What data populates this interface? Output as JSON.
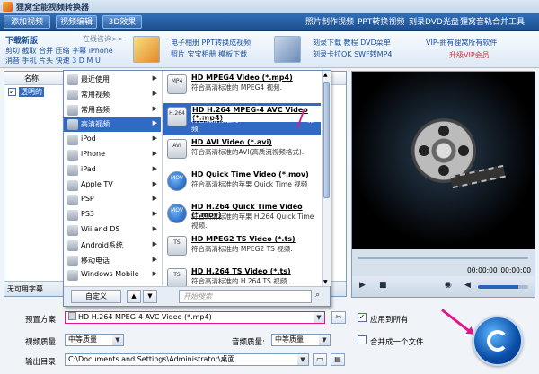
{
  "window": {
    "title": "狸窝全能视频转换器"
  },
  "toolbar": {
    "add_video": "添加视频",
    "edit_video": "视频编辑",
    "effect_3d": "3D效果",
    "links": [
      "照片制作视频",
      "PPT转换视频",
      "刻录DVD光盘",
      "狸窝音轨合并工具"
    ]
  },
  "promo": {
    "download_title": "下载新版",
    "online_help": "在线咨询>>",
    "left_lines": [
      "剪切 截取 合并 压缩 字幕 iPhone",
      "消音 手机 片头 快速 3 D M U"
    ],
    "mid_lines": [
      "电子相册 PPT转换成视频",
      "照片 宝宝相册 模板下载"
    ],
    "right_lines": [
      "刻录下载 教程 DVD菜单",
      "刻录卡拉OK SWF转MP4"
    ],
    "vip_line": "VIP-拥有狸窝所有软件",
    "vip_upgrade": "升级VIP会员"
  },
  "file_list": {
    "col_name": "名称",
    "row_file": "透明的",
    "subtitle_label": "无可用字幕"
  },
  "dropdown": {
    "categories": [
      {
        "label": "最近使用",
        "icon": "recent-icon"
      },
      {
        "label": "常用视频",
        "icon": "video-icon"
      },
      {
        "label": "常用音频",
        "icon": "audio-icon"
      },
      {
        "label": "高清视频",
        "icon": "hd-icon"
      },
      {
        "label": "iPod",
        "icon": "ipod-icon"
      },
      {
        "label": "iPhone",
        "icon": "iphone-icon"
      },
      {
        "label": "iPad",
        "icon": "ipad-icon"
      },
      {
        "label": "Apple TV",
        "icon": "appletv-icon"
      },
      {
        "label": "PSP",
        "icon": "psp-icon"
      },
      {
        "label": "PS3",
        "icon": "ps3-icon"
      },
      {
        "label": "Wii and DS",
        "icon": "wii-icon"
      },
      {
        "label": "Android系统",
        "icon": "android-icon"
      },
      {
        "label": "移动电话",
        "icon": "mobile-icon"
      },
      {
        "label": "Windows Mobile",
        "icon": "winmobile-icon"
      }
    ],
    "selected_category": 3,
    "formats": [
      {
        "title": "HD MPEG4 Video (*.mp4)",
        "desc": "符合高清标准的 MPEG4 视频.",
        "tag": "MP4"
      },
      {
        "title": "HD H.264 MPEG-4 AVC Video (*.mp4)",
        "desc": "符合高清标准的 H.264 MPEG-4 AVC 视频.",
        "tag": "H.264"
      },
      {
        "title": "HD AVI Video (*.avi)",
        "desc": "符合高清标准的AVI(高质流视频格式).",
        "tag": "AVI"
      },
      {
        "title": "HD Quick Time Video (*.mov)",
        "desc": "符合高清标准的苹果 Quick Time 视频",
        "tag": "MOV"
      },
      {
        "title": "HD H.264 Quick Time Video (*.mov)",
        "desc": "符合高清标准的苹果 H.264 Quick Time 视频.",
        "tag": "MOV"
      },
      {
        "title": "HD MPEG2 TS Video (*.ts)",
        "desc": "符合高清标准的 MPEG2 TS 视频.",
        "tag": "TS"
      },
      {
        "title": "HD H.264 TS Video (*.ts)",
        "desc": "符合高清标准的 H.264 TS 视频.",
        "tag": "TS"
      }
    ],
    "custom_label": "自定义",
    "search_placeholder": "开始搜索"
  },
  "preview": {
    "time_current": "00:00:00",
    "time_total": "00:00:00"
  },
  "settings": {
    "preset_label": "预置方案:",
    "preset_value": "HD H.264 MPEG-4 AVC Video (*.mp4)",
    "apply_all": "应用到所有",
    "video_quality_label": "视频质量:",
    "video_quality_value": "中等质量",
    "audio_quality_label": "音频质量:",
    "audio_quality_value": "中等质量",
    "merge_label": "合并成一个文件",
    "output_label": "输出目录:",
    "output_value": "C:\\Documents and Settings\\Administrator\\桌面"
  },
  "colors": {
    "accent": "#316ac5",
    "highlight": "#e2168a",
    "toolbar": "#1d4f8f"
  }
}
